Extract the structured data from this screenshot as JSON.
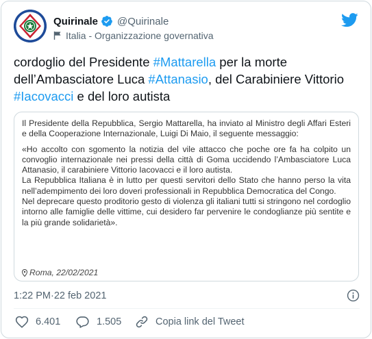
{
  "author": {
    "display_name": "Quirinale",
    "handle": "@Quirinale",
    "label": "Italia - Organizzazione governativa",
    "avatar": "quirinale-emblem",
    "verified": true
  },
  "tweet": {
    "text_1": "cordoglio del Presidente ",
    "hashtag_1": "#Mattarella",
    "text_2": " per la morte dell’Ambasciatore Luca ",
    "hashtag_2": "#Attanasio",
    "text_3": ", del Carabiniere Vittorio ",
    "hashtag_3": "#Iacovacci",
    "text_4": " e del loro autista"
  },
  "statement": {
    "intro": "Il Presidente della Repubblica, Sergio Mattarella, ha inviato al Ministro degli Affari Esteri e della Cooperazione Internazionale, Luigi Di Maio, il seguente messaggio:",
    "paragraph_1": "«Ho accolto con sgomento la notizia del vile attacco che poche ore fa ha colpito un convoglio internazionale nei pressi della città di Goma uccidendo l’Ambasciatore Luca Attanasio, il carabiniere Vittorio Iacovacci e il loro autista.",
    "paragraph_2": "La Repubblica Italiana è in lutto per questi servitori dello Stato che hanno perso la vita nell’adempimento dei loro doveri professionali in Repubblica Democratica del Congo.",
    "paragraph_3": "Nel deprecare questo proditorio gesto di violenza gli italiani tutti si stringono nel cordoglio intorno alle famiglie delle vittime, cui desidero far pervenire le condoglianze più sentite e la più grande solidarietà».",
    "location_date": "Roma, 22/02/2021"
  },
  "meta": {
    "time": "1:22 PM",
    "separator": " · ",
    "date": "22 feb 2021"
  },
  "actions": {
    "likes": "6.401",
    "replies": "1.505",
    "copy_link": "Copia link del Tweet"
  },
  "colors": {
    "accent": "#1d9bf0",
    "text": "#0f1419",
    "secondary": "#536471",
    "border": "#cfd9de",
    "avatar_bg": "#1e4b99",
    "emblem_green": "#1a7a3a"
  }
}
